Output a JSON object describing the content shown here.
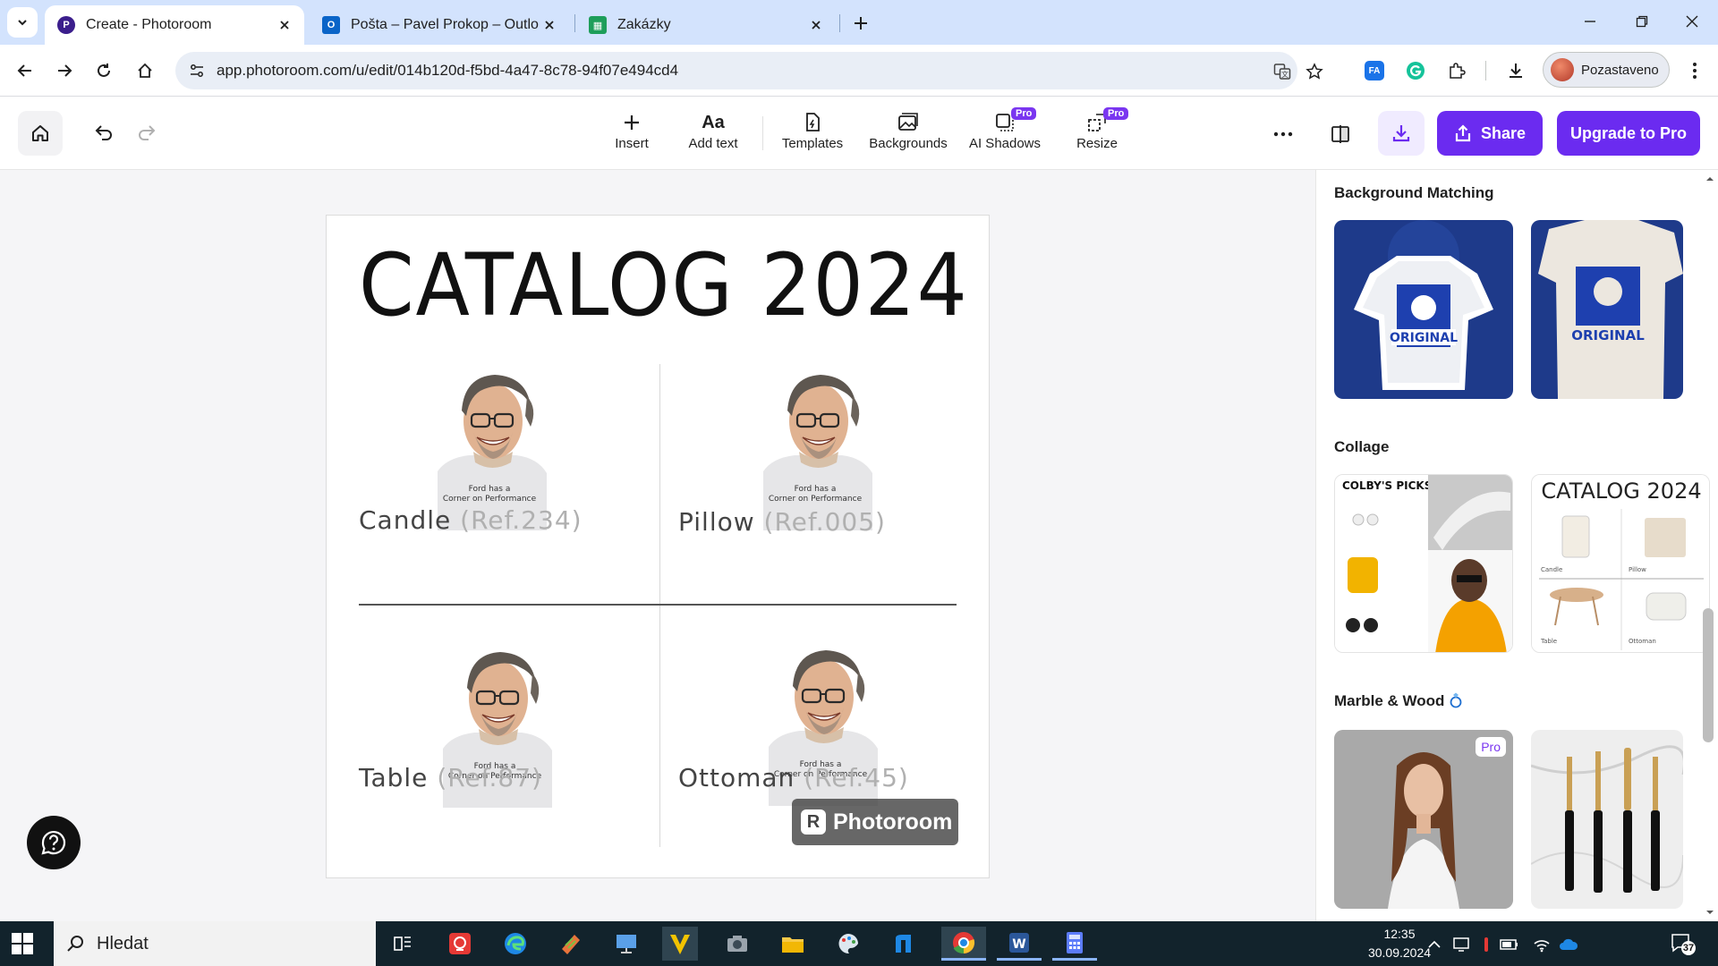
{
  "browser": {
    "tabs": [
      {
        "title": "Create - Photoroom",
        "icon": "photoroom-favicon",
        "active": true
      },
      {
        "title": "Pošta – Pavel Prokop – Outlook",
        "icon": "outlook-favicon",
        "active": false
      },
      {
        "title": "Zakázky",
        "icon": "sheets-favicon",
        "active": false
      }
    ],
    "url": "app.photoroom.com/u/edit/014b120d-f5bd-4a47-8c78-94f07e494cd4",
    "profile_label": "Pozastaveno",
    "extension_fa_label": "FA"
  },
  "toolbar": {
    "tools": [
      {
        "label": "Insert",
        "icon": "plus-icon"
      },
      {
        "label": "Add text",
        "icon": "text-icon",
        "glyph": "Aa"
      },
      {
        "label": "Templates",
        "icon": "templates-icon"
      },
      {
        "label": "Backgrounds",
        "icon": "backgrounds-icon"
      },
      {
        "label": "AI Shadows",
        "icon": "ai-shadows-icon",
        "badge": "Pro"
      },
      {
        "label": "Resize",
        "icon": "resize-icon",
        "badge": "Pro"
      }
    ],
    "share_label": "Share",
    "upgrade_label": "Upgrade to Pro"
  },
  "canvas": {
    "title": "CATALOG 2024",
    "products": [
      {
        "name": "Candle",
        "ref": "(Ref.234)",
        "shirt_text_1": "Ford has a",
        "shirt_text_2": "Corner on Performance"
      },
      {
        "name": "Pillow",
        "ref": "(Ref.005)",
        "shirt_text_1": "Ford has a",
        "shirt_text_2": "Corner on Performance"
      },
      {
        "name": "Table",
        "ref": "(Ref.87)",
        "shirt_text_1": "Ford has a",
        "shirt_text_2": "Corner on Performance"
      },
      {
        "name": "Ottoman",
        "ref": "(Ref.45)",
        "shirt_text_1": "Ford has a",
        "shirt_text_2": "Corner on Performance"
      }
    ],
    "watermark": "Photoroom"
  },
  "panel": {
    "sections": [
      {
        "title": "Background Matching",
        "thumb_text": "ORIGINAL"
      },
      {
        "title": "Collage",
        "collage_1_title": "COLBY'S PICKS",
        "collage_2_title": "CATALOG 2024",
        "collage_2_items": [
          "Candle",
          "Pillow",
          "Table",
          "Ottoman"
        ]
      },
      {
        "title": "Marble & Wood",
        "badge": "Pro"
      }
    ]
  },
  "taskbar": {
    "search_placeholder": "Hledat",
    "time": "12:35",
    "date": "30.09.2024",
    "notifications": "37"
  },
  "colors": {
    "accent": "#6b2bf0",
    "tabstrip": "#d3e3fd",
    "taskbar": "#12232c",
    "pro_badge": "#7a36f0"
  }
}
